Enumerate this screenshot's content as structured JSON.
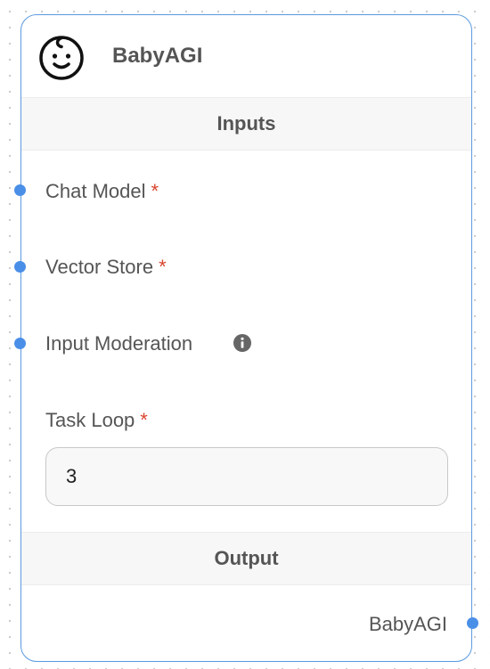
{
  "node": {
    "title": "BabyAGI",
    "icon": "baby-face-icon"
  },
  "inputs_section": {
    "label": "Inputs"
  },
  "params": {
    "chat_model": {
      "label": "Chat Model",
      "required_mark": "*"
    },
    "vector_store": {
      "label": "Vector Store",
      "required_mark": "*"
    },
    "input_moderation": {
      "label": "Input Moderation",
      "info_icon": "info-icon"
    },
    "task_loop": {
      "label": "Task Loop",
      "required_mark": "*",
      "value": "3"
    }
  },
  "output_section": {
    "label": "Output",
    "output_label": "BabyAGI"
  },
  "colors": {
    "accent": "#4a8fe7",
    "node_border": "#5b9ae0",
    "required": "#d9442f",
    "text": "#555555"
  }
}
